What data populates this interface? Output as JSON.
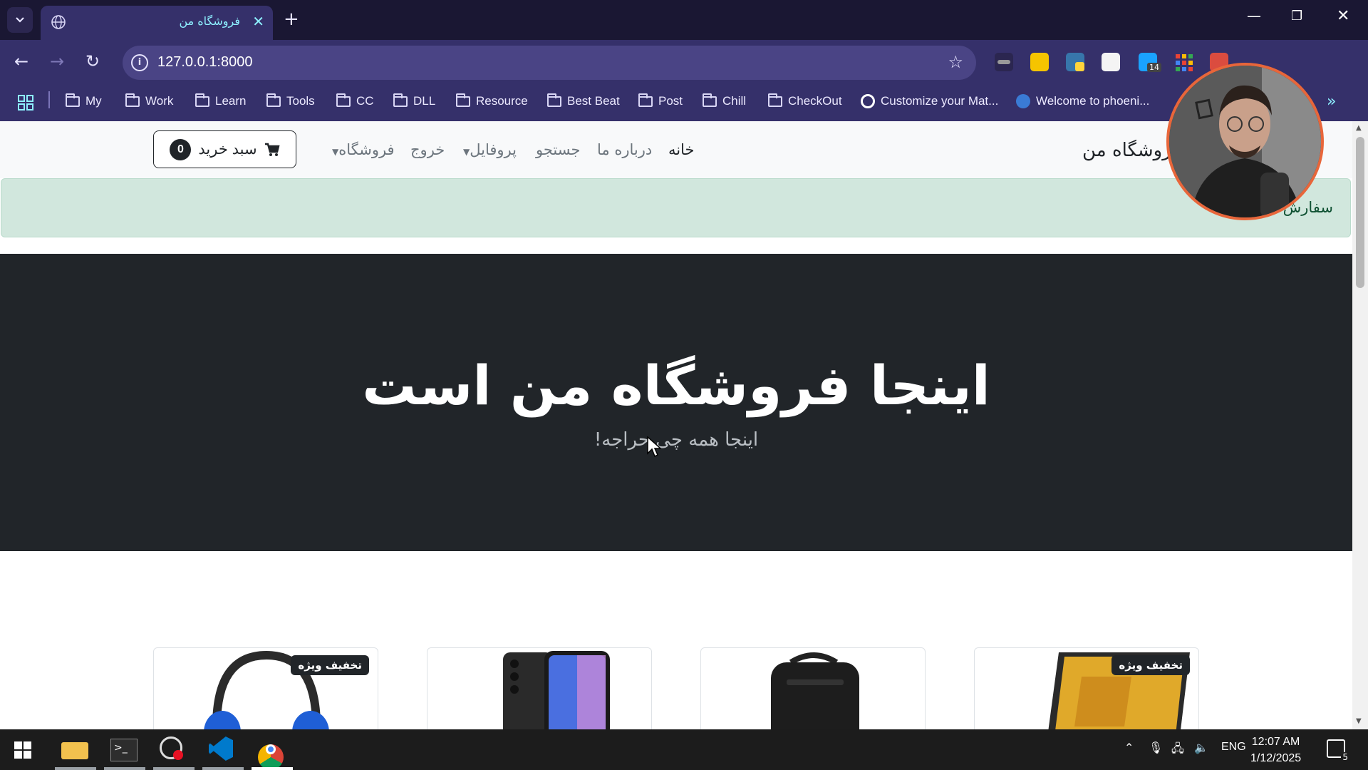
{
  "browser": {
    "tab_title": "فروشگاه من",
    "url": "127.0.0.1:8000",
    "bookmarks": [
      {
        "label": "My"
      },
      {
        "label": "Work"
      },
      {
        "label": "Learn"
      },
      {
        "label": "Tools"
      },
      {
        "label": "CC"
      },
      {
        "label": "DLL"
      },
      {
        "label": "Resource"
      },
      {
        "label": "Best Beat"
      },
      {
        "label": "Post"
      },
      {
        "label": "Chill"
      },
      {
        "label": "CheckOut"
      },
      {
        "label": "Customize your Mat..."
      },
      {
        "label": "Welcome to phoeni..."
      }
    ],
    "extension_badge": "14"
  },
  "navbar": {
    "brand": "فروشگاه من",
    "links": {
      "home": "خانه",
      "about": "درباره ما",
      "search": "جستجو",
      "profile": "پروفایل",
      "logout": "خروج",
      "shop": "فروشگاه"
    },
    "cart_label": "سبد خرید",
    "cart_count": "0"
  },
  "alert": {
    "text": "سفارش ..."
  },
  "hero": {
    "title": "اینجا فروشگاه من است",
    "subtitle": "اینجا همه چی حراجه!"
  },
  "products": [
    {
      "badge": "تخفیف ویژه",
      "image": "headphones"
    },
    {
      "badge": "",
      "image": "smartphone"
    },
    {
      "badge": "",
      "image": "backpack"
    },
    {
      "badge": "تخفیف ویژه",
      "image": "laptop"
    }
  ],
  "taskbar": {
    "language": "ENG",
    "time": "12:07 AM",
    "date": "1/12/2025",
    "notifications": "5"
  },
  "colors": {
    "chrome_dark": "#1a1733",
    "chrome": "#35306a",
    "alert_bg": "#d1e7dd",
    "hero_bg": "#212529",
    "webcam_ring": "#e8663a"
  }
}
